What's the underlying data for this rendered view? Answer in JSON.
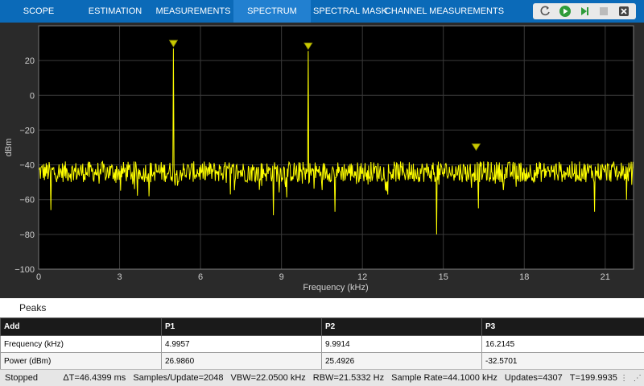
{
  "toolstrip": {
    "tabs": [
      {
        "label": "SCOPE",
        "active": false
      },
      {
        "label": "ESTIMATION",
        "active": false
      },
      {
        "label": "MEASUREMENTS",
        "active": false
      },
      {
        "label": "SPECTRUM",
        "active": true
      },
      {
        "label": "SPECTRAL MASK",
        "active": false
      },
      {
        "label": "CHANNEL MEASUREMENTS",
        "active": false
      }
    ],
    "controls": [
      "stepback-icon",
      "run-icon",
      "step-forward-icon",
      "stop-icon",
      "close-icon"
    ]
  },
  "plot": {
    "ylabel": "dBm",
    "xlabel": "Frequency (kHz)",
    "background": "#000000",
    "trace_color": "#ffff00",
    "marker_color": "#c9c900"
  },
  "chart_data": {
    "type": "line",
    "xlabel": "Frequency (kHz)",
    "ylabel": "dBm",
    "xlim": [
      0,
      22.05
    ],
    "ylim": [
      -100,
      40
    ],
    "xticks": [
      0,
      3,
      6,
      9,
      12,
      15,
      18,
      21
    ],
    "yticks": [
      20,
      0,
      -20,
      -40,
      -60,
      -80,
      -100
    ],
    "ytick_labels": [
      "20",
      "0",
      "−20",
      "−40",
      "−60",
      "−80",
      "−100"
    ],
    "grid": true,
    "noise_floor_dbm": -44,
    "tones": [
      {
        "x": 4.9957,
        "y": 26.986
      },
      {
        "x": 9.9914,
        "y": 25.4926
      }
    ],
    "dips": [
      {
        "x": 14.75,
        "y": -80
      },
      {
        "x": 10.98,
        "y": -67
      },
      {
        "x": 8.7,
        "y": -69
      },
      {
        "x": 0.45,
        "y": -66
      },
      {
        "x": 20.6,
        "y": -67
      },
      {
        "x": 21.8,
        "y": -60
      },
      {
        "x": 16.3,
        "y": -65
      }
    ],
    "peaks_markers": [
      {
        "x": 4.9957,
        "y": 26.986
      },
      {
        "x": 9.9914,
        "y": 25.4926
      },
      {
        "x": 16.2145,
        "y": -32.5701
      }
    ]
  },
  "peaks": {
    "title": "Peaks",
    "header": [
      "Add",
      "P1",
      "P2",
      "P3"
    ],
    "rows": [
      [
        "Frequency (kHz)",
        "4.9957",
        "9.9914",
        "16.2145"
      ],
      [
        "Power (dBm)",
        "26.9860",
        "25.4926",
        "-32.5701"
      ]
    ]
  },
  "status": {
    "state": "Stopped",
    "metrics": [
      "ΔT=46.4399 ms",
      "Samples/Update=2048",
      "VBW=22.0500 kHz",
      "RBW=21.5332 Hz",
      "Sample Rate=44.1000 kHz",
      "Updates=4307",
      "T=199.9935"
    ]
  }
}
